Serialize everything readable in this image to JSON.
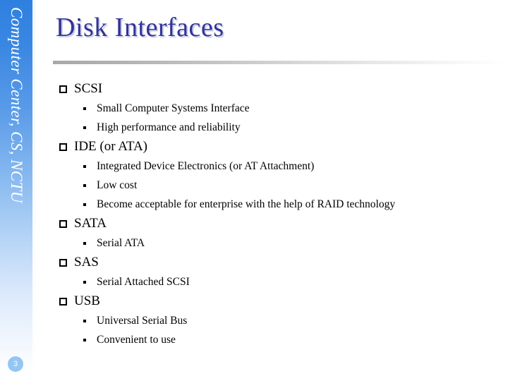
{
  "slide": {
    "title": "Disk Interfaces",
    "number": "3",
    "sidebar_label": "Computer Center, CS, NCTU",
    "colors": {
      "title": "#333399",
      "title_shadow": "#c9cfe8",
      "sidebar_top": "#2e80e0",
      "sidebar_bottom": "#ffffff",
      "slide_number_badge": "#93c6f2",
      "divider_left": "#a8a8a8",
      "body_text": "#000000"
    }
  },
  "content": {
    "items": [
      {
        "label": "SCSI",
        "subitems": [
          "Small Computer Systems Interface",
          "High performance and reliability"
        ]
      },
      {
        "label": "IDE (or ATA)",
        "subitems": [
          "Integrated Device Electronics (or AT Attachment)",
          "Low cost",
          "Become acceptable for enterprise with the help of RAID technology"
        ]
      },
      {
        "label": "SATA",
        "subitems": [
          "Serial ATA"
        ]
      },
      {
        "label": "SAS",
        "subitems": [
          "Serial Attached SCSI"
        ]
      },
      {
        "label": "USB",
        "subitems": [
          "Universal Serial Bus",
          "Convenient to use"
        ]
      }
    ]
  }
}
